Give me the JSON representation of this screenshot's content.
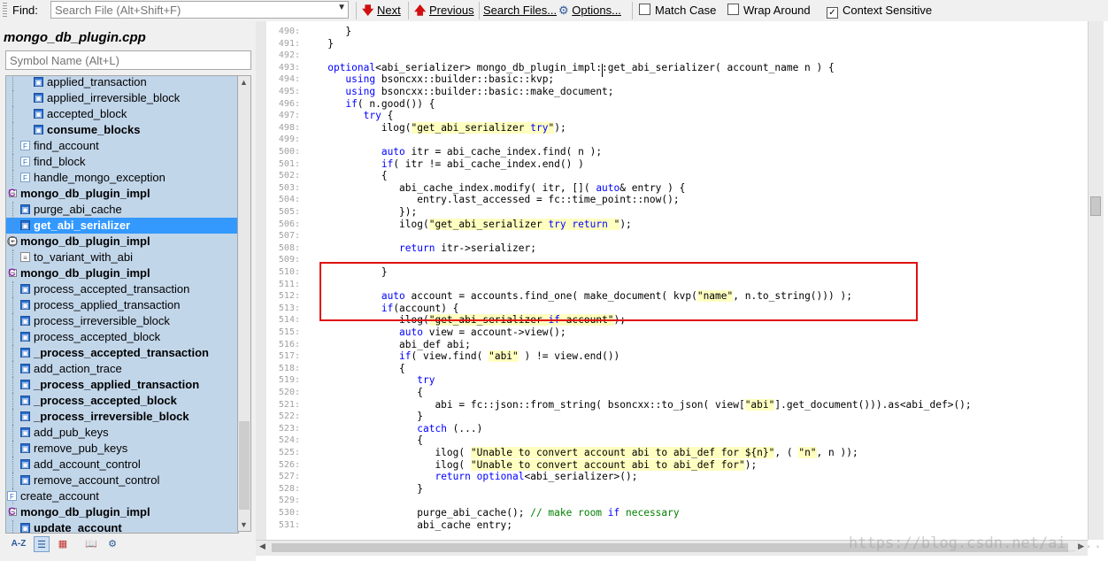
{
  "findbar": {
    "find_label": "Find:",
    "search_placeholder": "Search File (Alt+Shift+F)",
    "next_label": "Next",
    "previous_label": "Previous",
    "search_files_label": "Search Files...",
    "options_label": "Options...",
    "match_case_label": "Match Case",
    "match_case_checked": false,
    "wrap_around_label": "Wrap Around",
    "wrap_around_checked": false,
    "context_sensitive_label": "Context Sensitive",
    "context_sensitive_checked": true
  },
  "left_panel": {
    "file_name": "mongo_db_plugin.cpp",
    "symbol_placeholder": "Symbol Name (Alt+L)",
    "tree_items": [
      {
        "label": "applied_transaction",
        "icon": "method-icon",
        "bold": false
      },
      {
        "label": "applied_irreversible_block",
        "icon": "method-icon",
        "bold": false
      },
      {
        "label": "accepted_block",
        "icon": "method-icon",
        "bold": false
      },
      {
        "label": "consume_blocks",
        "icon": "method-icon",
        "bold": true
      },
      {
        "label": "find_account",
        "icon": "function-icon",
        "bold": false
      },
      {
        "label": "find_block",
        "icon": "function-icon",
        "bold": false
      },
      {
        "label": "handle_mongo_exception",
        "icon": "function-icon",
        "bold": false
      },
      {
        "label": "mongo_db_plugin_impl",
        "icon": "class-icon",
        "bold": true
      },
      {
        "label": "purge_abi_cache",
        "icon": "method-icon",
        "bold": false
      },
      {
        "label": "get_abi_serializer",
        "icon": "method-icon",
        "bold": true,
        "selected": true
      },
      {
        "label": "mongo_db_plugin_impl",
        "icon": "class-expand-icon",
        "bold": true
      },
      {
        "label": "to_variant_with_abi",
        "icon": "struct-icon",
        "bold": false
      },
      {
        "label": "mongo_db_plugin_impl",
        "icon": "class-icon",
        "bold": true
      },
      {
        "label": "process_accepted_transaction",
        "icon": "method-icon",
        "bold": false
      },
      {
        "label": "process_applied_transaction",
        "icon": "method-icon",
        "bold": false
      },
      {
        "label": "process_irreversible_block",
        "icon": "method-icon",
        "bold": false
      },
      {
        "label": "process_accepted_block",
        "icon": "method-icon",
        "bold": false
      },
      {
        "label": "_process_accepted_transaction",
        "icon": "method-icon",
        "bold": true
      },
      {
        "label": "add_action_trace",
        "icon": "method-icon",
        "bold": false
      },
      {
        "label": "_process_applied_transaction",
        "icon": "method-icon",
        "bold": true
      },
      {
        "label": "_process_accepted_block",
        "icon": "method-icon",
        "bold": true
      },
      {
        "label": "_process_irreversible_block",
        "icon": "method-icon",
        "bold": true
      },
      {
        "label": "add_pub_keys",
        "icon": "method-icon",
        "bold": false
      },
      {
        "label": "remove_pub_keys",
        "icon": "method-icon",
        "bold": false
      },
      {
        "label": "add_account_control",
        "icon": "method-icon",
        "bold": false
      },
      {
        "label": "remove_account_control",
        "icon": "method-icon",
        "bold": false
      },
      {
        "label": "create_account",
        "icon": "function-icon",
        "bold": false
      },
      {
        "label": "mongo_db_plugin_impl",
        "icon": "class-icon",
        "bold": true
      },
      {
        "label": "update_account",
        "icon": "method-icon",
        "bold": true
      }
    ],
    "toolbar_icons": [
      "sort-az-icon",
      "list-view-icon",
      "categories-icon",
      "book-icon",
      "gear-icon"
    ]
  },
  "code": {
    "line_numbers": [
      "490:",
      "491:",
      "492:",
      "493:",
      "494:",
      "495:",
      "496:",
      "497:",
      "498:",
      "499:",
      "500:",
      "501:",
      "502:",
      "503:",
      "504:",
      "505:",
      "506:",
      "507:",
      "508:",
      "509:",
      "510:",
      "511:",
      "512:",
      "513:",
      "514:",
      "515:",
      "516:",
      "517:",
      "518:",
      "519:",
      "520:",
      "521:",
      "522:",
      "523:",
      "524:",
      "525:",
      "526:",
      "527:",
      "528:",
      "529:",
      "530:",
      "531:"
    ],
    "lines": [
      "      }",
      "   }",
      "",
      "   optional<abi_serializer> mongo_db_plugin_impl::get_abi_serializer( account_name n ) {",
      "      using bsoncxx::builder::basic::kvp;",
      "      using bsoncxx::builder::basic::make_document;",
      "      if( n.good()) {",
      "         try {",
      "            ilog(\"get_abi_serializer try\");",
      "",
      "            auto itr = abi_cache_index.find( n );",
      "            if( itr != abi_cache_index.end() )",
      "            {",
      "               abi_cache_index.modify( itr, []( auto& entry ) {",
      "                  entry.last_accessed = fc::time_point::now();",
      "               });",
      "               ilog(\"get_abi_serializer try return \");",
      "",
      "               return itr->serializer;",
      "",
      "            }",
      "",
      "            auto account = accounts.find_one( make_document( kvp(\"name\", n.to_string())) );",
      "            if(account) {",
      "               ilog(\"get_abi_serializer if account\");",
      "               auto view = account->view();",
      "               abi_def abi;",
      "               if( view.find( \"abi\" ) != view.end())",
      "               {",
      "                  try",
      "                  {",
      "                     abi = fc::json::from_string( bsoncxx::to_json( view[\"abi\"].get_document())).as<abi_def>();",
      "                  }",
      "                  catch (...)",
      "                  {",
      "                     ilog( \"Unable to convert account abi to abi_def for ${n}\", ( \"n\", n ));",
      "                     ilog( \"Unable to convert account abi to abi_def for\");",
      "                     return optional<abi_serializer>();",
      "                  }",
      "",
      "                  purge_abi_cache(); // make room if necessary",
      "                  abi_cache entry;"
    ]
  },
  "watermark": "https://blog.csdn.net/ai_..."
}
